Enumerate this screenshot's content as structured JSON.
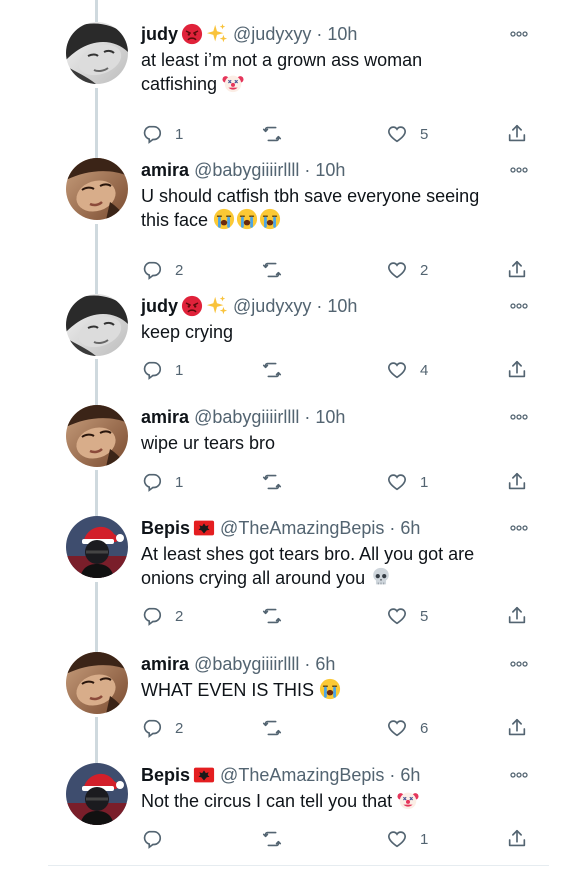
{
  "tweets": [
    {
      "name": "judy",
      "badges": [
        "angry-face",
        "sparkles"
      ],
      "handle": "@judyxyy",
      "time": "10h",
      "lines": [
        "at least i’m not a grown ass woman",
        "catfishing"
      ],
      "trailing_emoji": [
        "clown-face"
      ],
      "replies": "1",
      "retweets": "",
      "likes": "5",
      "avatar": "judy"
    },
    {
      "name": "amira",
      "badges": [],
      "handle": "@babygiiiirllll",
      "time": "10h",
      "lines": [
        "U should catfish tbh save everyone seeing",
        "this face"
      ],
      "trailing_emoji": [
        "crying-face",
        "crying-face",
        "crying-face"
      ],
      "replies": "2",
      "retweets": "",
      "likes": "2",
      "avatar": "amira"
    },
    {
      "name": "judy",
      "badges": [
        "angry-face",
        "sparkles"
      ],
      "handle": "@judyxyy",
      "time": "10h",
      "lines": [
        "keep crying"
      ],
      "trailing_emoji": [],
      "replies": "1",
      "retweets": "",
      "likes": "4",
      "avatar": "judy"
    },
    {
      "name": "amira",
      "badges": [],
      "handle": "@babygiiiirllll",
      "time": "10h",
      "lines": [
        "wipe ur tears bro"
      ],
      "trailing_emoji": [],
      "replies": "1",
      "retweets": "",
      "likes": "1",
      "avatar": "amira"
    },
    {
      "name": "Bepis",
      "badges": [
        "albania-flag"
      ],
      "handle": "@TheAmazingBepis",
      "time": "6h",
      "lines": [
        "At least shes got tears bro. All you got are",
        "onions crying all around you"
      ],
      "trailing_emoji": [
        "skull"
      ],
      "replies": "2",
      "retweets": "",
      "likes": "5",
      "avatar": "bepis"
    },
    {
      "name": "amira",
      "badges": [],
      "handle": "@babygiiiirllll",
      "time": "6h",
      "lines": [
        "WHAT EVEN IS THIS"
      ],
      "trailing_emoji": [
        "crying-face"
      ],
      "replies": "2",
      "retweets": "",
      "likes": "6",
      "avatar": "amira"
    },
    {
      "name": "Bepis",
      "badges": [
        "albania-flag"
      ],
      "handle": "@TheAmazingBepis",
      "time": "6h",
      "lines": [
        "Not the circus I can tell you that"
      ],
      "trailing_emoji": [
        "clown-face"
      ],
      "replies": "",
      "retweets": "",
      "likes": "1",
      "avatar": "bepis"
    }
  ],
  "dot": "·",
  "colors": {
    "text": "#0f1419",
    "muted": "#536471",
    "thread": "#cfd9de"
  }
}
